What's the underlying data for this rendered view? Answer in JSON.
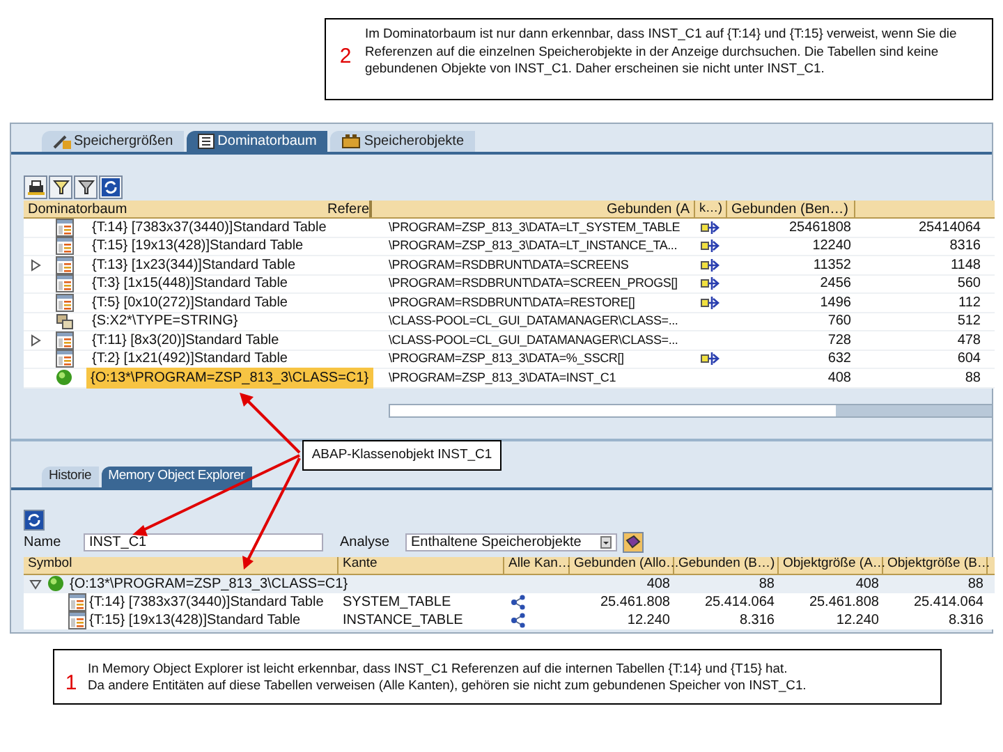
{
  "note_top": {
    "number": "2",
    "text": "Im Dominatorbaum ist nur dann erkennbar, dass INST_C1 auf {T:14} und {T:15} verweist, wenn Sie die Referenzen auf die einzelnen Speicherobjekte in der Anzeige durchsuchen. Die Tabellen sind keine gebundenen Objekte von INST_C1. Daher erscheinen sie nicht unter INST_C1."
  },
  "upper": {
    "tabs": [
      {
        "label": "Speichergrößen",
        "kind": "tools",
        "selected": false
      },
      {
        "label": "Dominatorbaum",
        "kind": "tree",
        "selected": true
      },
      {
        "label": "Speicherobjekte",
        "kind": "objects",
        "selected": false
      }
    ],
    "columns": [
      "Dominatorbaum",
      "Refere",
      "Gebunden (A",
      "k…)",
      "Gebunden (Ben…)"
    ],
    "rows": [
      {
        "kind": "table",
        "expandable": false,
        "selected": false,
        "name": "{T:14} [7383x37(3440)]Standard Table",
        "reference": "\\PROGRAM=ZSP_813_3\\DATA=LT_SYSTEM_TABLE",
        "link": true,
        "value_1": "25461808",
        "value_2": "25414064"
      },
      {
        "kind": "table",
        "expandable": false,
        "selected": false,
        "name": "{T:15} [19x13(428)]Standard Table",
        "reference": "\\PROGRAM=ZSP_813_3\\DATA=LT_INSTANCE_TA...",
        "link": true,
        "value_1": "12240",
        "value_2": "8316"
      },
      {
        "kind": "table",
        "expandable": true,
        "selected": false,
        "name": "{T:13} [1x23(344)]Standard Table",
        "reference": "\\PROGRAM=RSDBRUNT\\DATA=SCREENS",
        "link": true,
        "value_1": "11352",
        "value_2": "1148"
      },
      {
        "kind": "table",
        "expandable": false,
        "selected": false,
        "name": "{T:3} [1x15(448)]Standard Table",
        "reference": "\\PROGRAM=RSDBRUNT\\DATA=SCREEN_PROGS[]",
        "link": true,
        "value_1": "2456",
        "value_2": "560"
      },
      {
        "kind": "table",
        "expandable": false,
        "selected": false,
        "name": "{T:5} [0x10(272)]Standard Table",
        "reference": "\\PROGRAM=RSDBRUNT\\DATA=RESTORE[]",
        "link": true,
        "value_1": "1496",
        "value_2": "112"
      },
      {
        "kind": "string",
        "expandable": false,
        "selected": false,
        "name": "{S:X2*\\TYPE=STRING}",
        "reference": "\\CLASS-POOL=CL_GUI_DATAMANAGER\\CLASS=...",
        "link": false,
        "value_1": "760",
        "value_2": "512"
      },
      {
        "kind": "table",
        "expandable": true,
        "selected": false,
        "name": "{T:11} [8x3(20)]Standard Table",
        "reference": "\\CLASS-POOL=CL_GUI_DATAMANAGER\\CLASS=...",
        "link": false,
        "value_1": "728",
        "value_2": "478"
      },
      {
        "kind": "table",
        "expandable": false,
        "selected": false,
        "name": "{T:2} [1x21(492)]Standard Table",
        "reference": "\\PROGRAM=ZSP_813_3\\DATA=%_SSCR[]",
        "link": true,
        "value_1": "632",
        "value_2": "604"
      },
      {
        "kind": "object",
        "expandable": false,
        "selected": true,
        "name": "{O:13*\\PROGRAM=ZSP_813_3\\CLASS=C1}",
        "reference": "\\PROGRAM=ZSP_813_3\\DATA=INST_C1",
        "link": false,
        "value_1": "408",
        "value_2": "88"
      }
    ]
  },
  "callout": {
    "text": "ABAP-Klassenobjekt INST_C1"
  },
  "lower": {
    "tabs": [
      {
        "label": "Historie",
        "selected": false
      },
      {
        "label": "Memory Object Explorer",
        "selected": true
      }
    ],
    "name_label": "Name",
    "name_value": "INST_C1",
    "analysis_label": "Analyse",
    "analysis_value": "Enthaltene Speicherobjekte",
    "columns": [
      "Symbol",
      "Kante",
      "Alle Kan…",
      "Gebunden (Allo…",
      "Gebunden (B…)",
      "Objektgröße (A…",
      "Objektgröße (B…"
    ],
    "rows": [
      {
        "kind": "object",
        "expanded": true,
        "name": "{O:13*\\PROGRAM=ZSP_813_3\\CLASS=C1}",
        "link": false,
        "values": [
          "408",
          "88",
          "408",
          "88"
        ],
        "children": [
          {
            "kind": "table",
            "name": "{T:14} [7383x37(3440)]Standard Table",
            "edge": "SYSTEM_TABLE",
            "link": true,
            "values": [
              "25.461.808",
              "25.414.064",
              "25.461.808",
              "25.414.064"
            ]
          },
          {
            "kind": "table",
            "name": "{T:15} [19x13(428)]Standard Table",
            "edge": "INSTANCE_TABLE",
            "link": true,
            "values": [
              "12.240",
              "8.316",
              "12.240",
              "8.316"
            ]
          }
        ]
      }
    ]
  },
  "note_bottom": {
    "number": "1",
    "lines": [
      "In Memory Object Explorer ist leicht erkennbar, dass INST_C1 Referenzen auf die internen Tabellen {T:14} und {T15} hat.",
      "Da andere Entitäten auf diese Tabellen verweisen (Alle Kanten), gehören sie nicht zum gebundenen Speicher von INST_C1."
    ]
  }
}
